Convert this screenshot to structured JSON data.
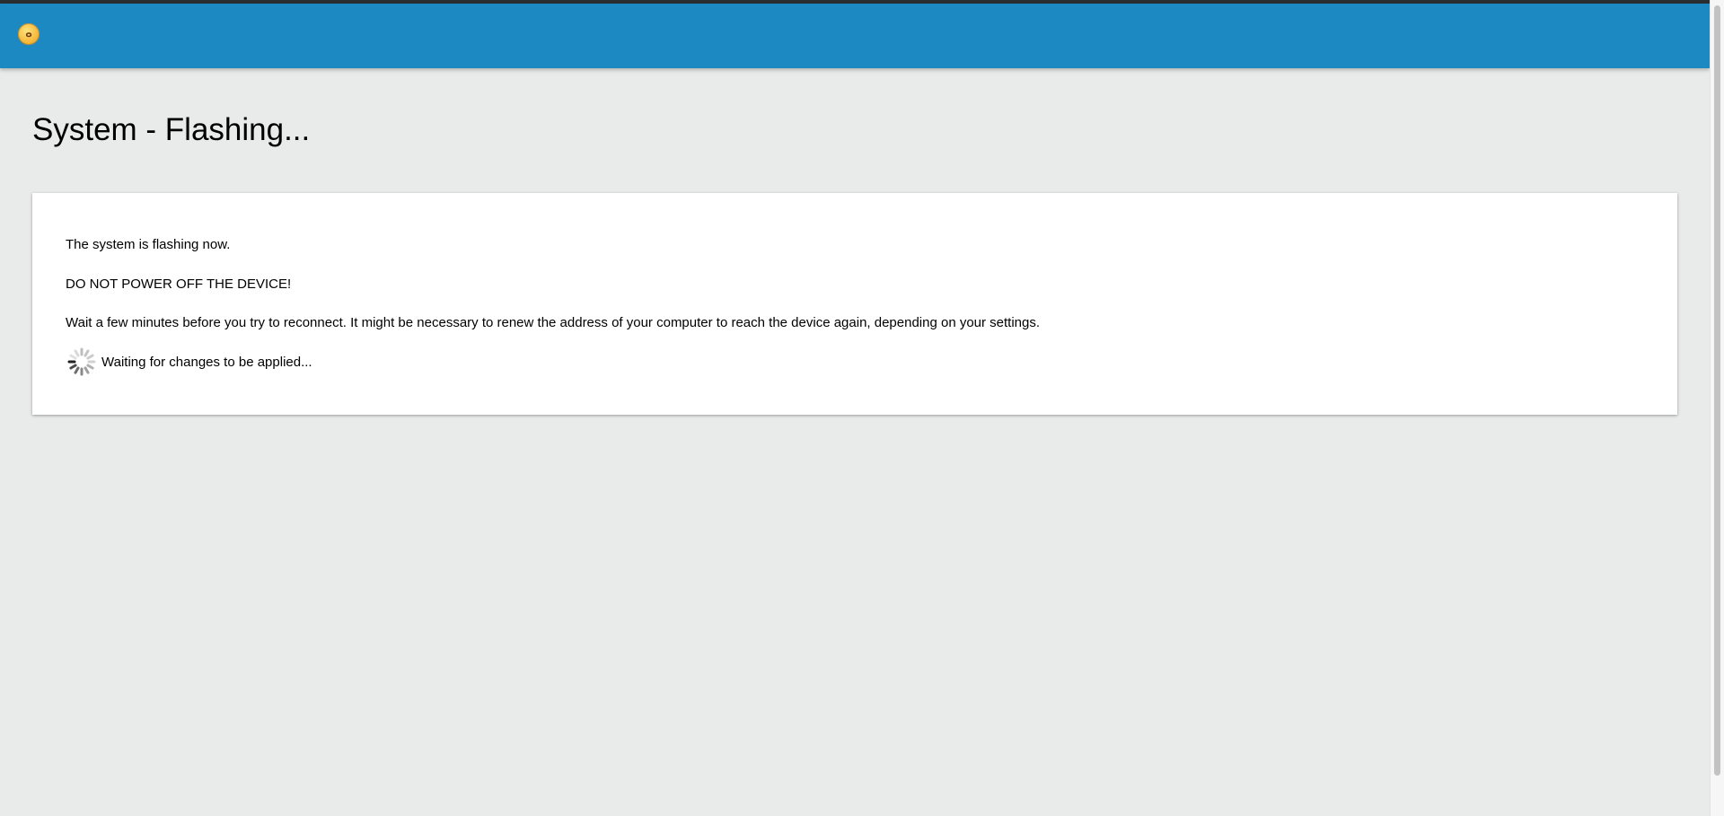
{
  "header": {
    "logo_icon": "emoji-logo-icon",
    "brand_color": "#1d89c3"
  },
  "page": {
    "title": "System - Flashing..."
  },
  "card": {
    "line1": "The system is flashing now.",
    "line2": "DO NOT POWER OFF THE DEVICE!",
    "line3": "Wait a few minutes before you try to reconnect. It might be necessary to renew the address of your computer to reach the device again, depending on your settings.",
    "status": "Waiting for changes to be applied...",
    "spinner_icon": "spinner-icon"
  }
}
